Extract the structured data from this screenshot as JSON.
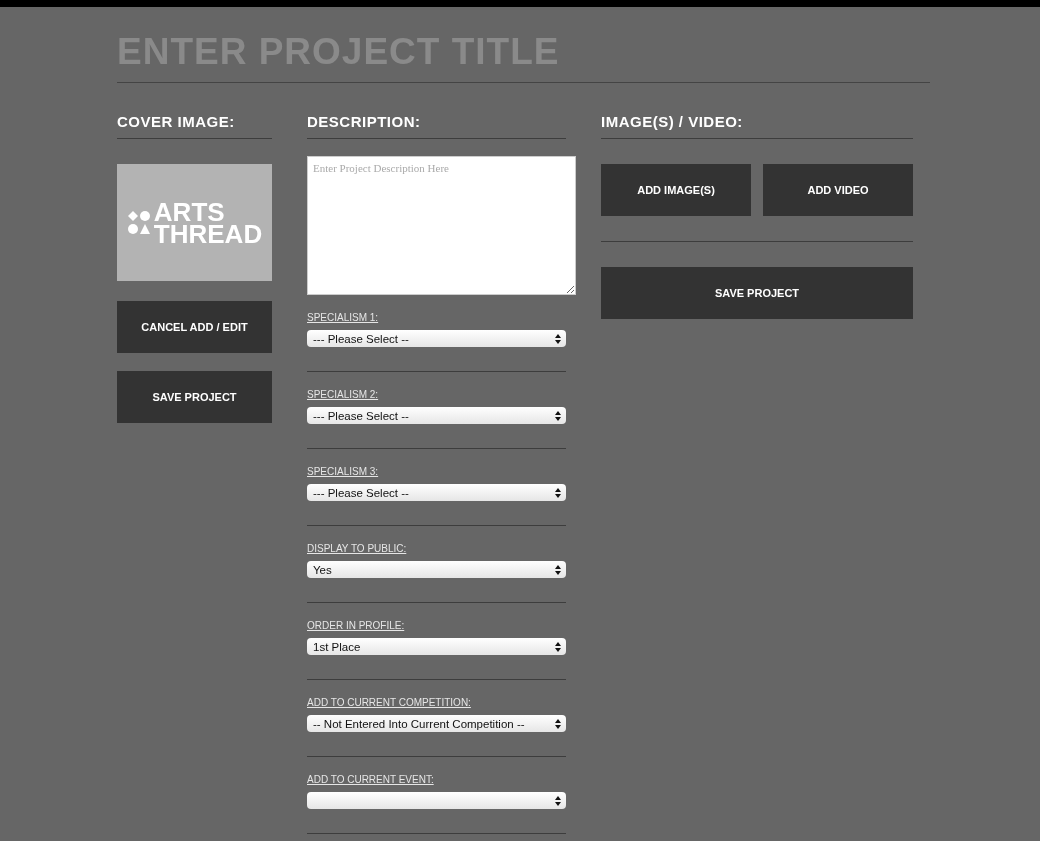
{
  "title": "ENTER PROJECT TITLE",
  "cover": {
    "heading": "COVER IMAGE:",
    "logo_lines": [
      "ARTS",
      "THREAD"
    ],
    "buttons": [
      "CANCEL ADD / EDIT",
      "SAVE PROJECT"
    ]
  },
  "description": {
    "heading": "DESCRIPTION:",
    "placeholder": "Enter Project Description Here",
    "fields": [
      {
        "label": "SPECIALISM 1:",
        "value": "--- Please Select --"
      },
      {
        "label": "SPECIALISM 2:",
        "value": "--- Please Select --"
      },
      {
        "label": "SPECIALISM 3:",
        "value": "--- Please Select --"
      },
      {
        "label": "DISPLAY TO PUBLIC:",
        "value": "Yes"
      },
      {
        "label": "ORDER IN PROFILE:",
        "value": "1st Place"
      },
      {
        "label": "ADD TO CURRENT COMPETITION:",
        "value": "-- Not Entered Into Current Competition --"
      },
      {
        "label": "ADD TO CURRENT EVENT:"
      }
    ]
  },
  "media": {
    "heading": "IMAGE(S) / VIDEO:",
    "buttons": [
      "ADD IMAGE(S)",
      "ADD VIDEO"
    ],
    "save": "SAVE PROJECT"
  }
}
